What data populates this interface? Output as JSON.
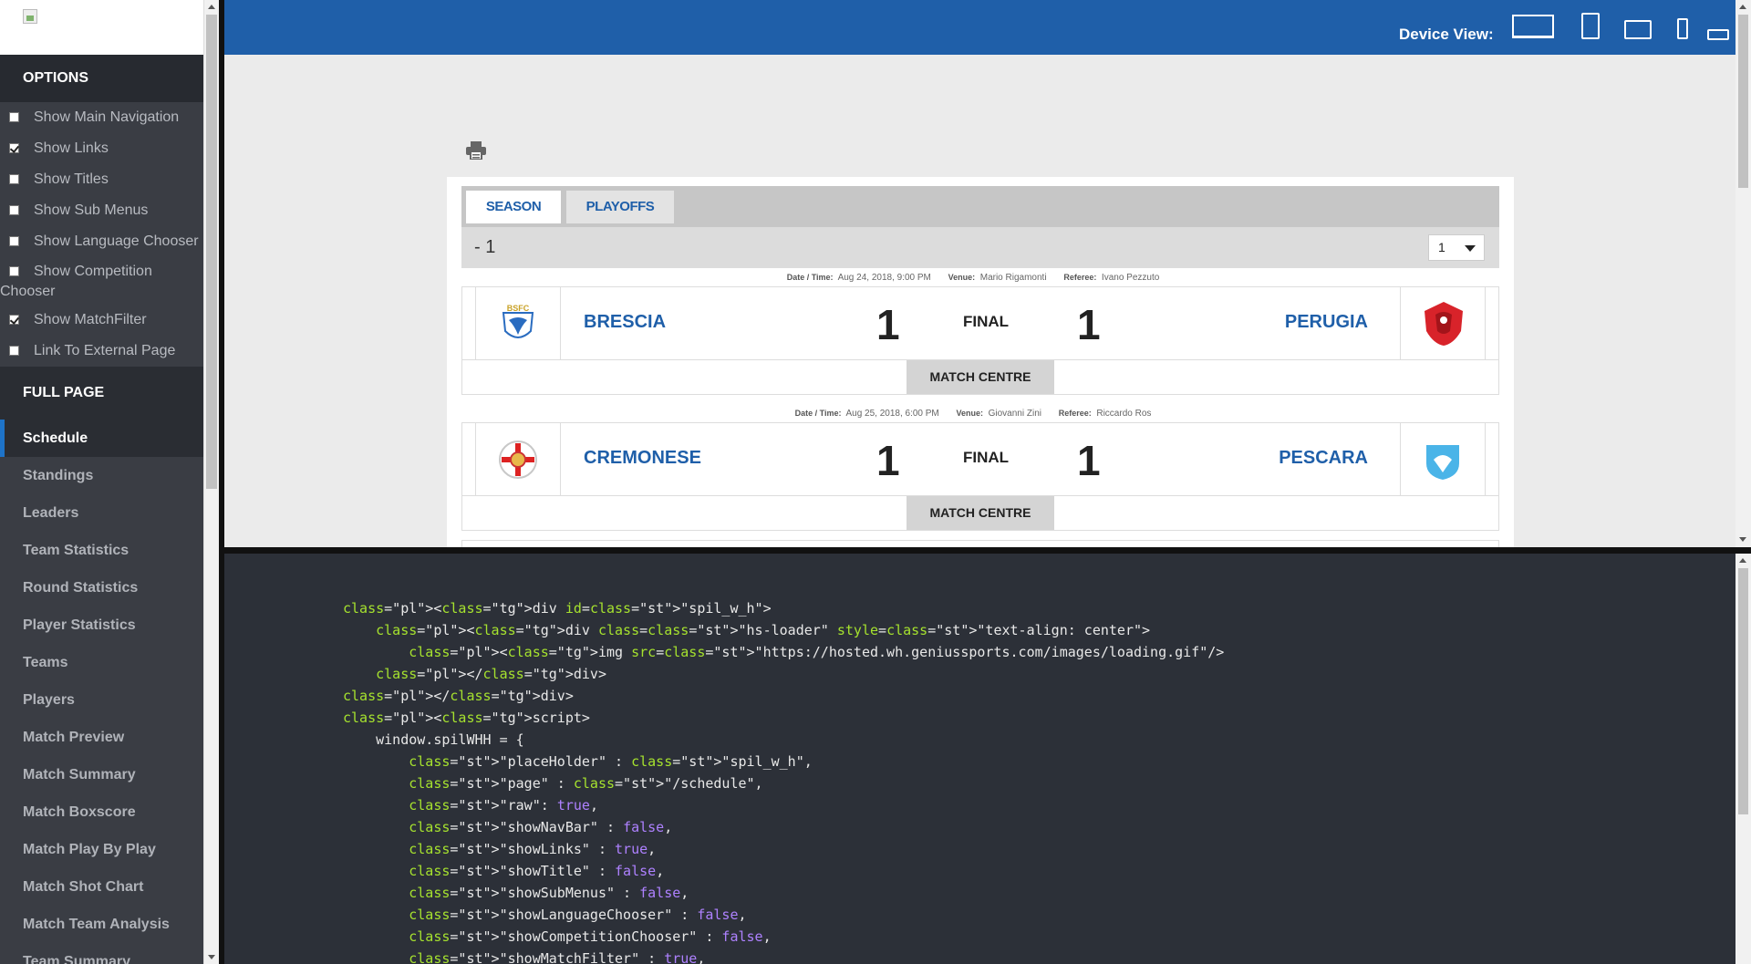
{
  "sidebar": {
    "options_title": "OPTIONS",
    "options": [
      {
        "label": "Show Main Navigation",
        "checked": false
      },
      {
        "label": "Show Links",
        "checked": true
      },
      {
        "label": "Show Titles",
        "checked": false
      },
      {
        "label": "Show Sub Menus",
        "checked": false
      },
      {
        "label": "Show Language Chooser",
        "checked": false
      },
      {
        "label": "Show Competition",
        "label2": "Chooser",
        "checked": false
      },
      {
        "label": "Show MatchFilter",
        "checked": true
      },
      {
        "label": "Link To External Page",
        "checked": false
      }
    ],
    "full_page_title": "FULL PAGE",
    "nav": [
      "Schedule",
      "Standings",
      "Leaders",
      "Team Statistics",
      "Round Statistics",
      "Player Statistics",
      "Teams",
      "Players",
      "Match Preview",
      "Match Summary",
      "Match Boxscore",
      "Match Play By Play",
      "Match Shot Chart",
      "Match Team Analysis",
      "Team Summary"
    ]
  },
  "topbar": {
    "device_view_label": "Device View:"
  },
  "widget": {
    "tabs": [
      "SEASON",
      "PLAYOFFS"
    ],
    "round_label": "- 1",
    "round_value": "1",
    "meta_labels": {
      "date": "Date / Time:",
      "venue": "Venue:",
      "referee": "Referee:"
    },
    "matches": [
      {
        "datetime": "Aug 24, 2018, 9:00 PM",
        "venue": "Mario Rigamonti",
        "referee": "Ivano Pezzuto",
        "home": "BRESCIA",
        "home_score": "1",
        "status": "FINAL",
        "away_score": "1",
        "away": "PERUGIA",
        "button": "MATCH CENTRE"
      },
      {
        "datetime": "Aug 25, 2018, 6:00 PM",
        "venue": "Giovanni Zini",
        "referee": "Riccardo Ros",
        "home": "CREMONESE",
        "home_score": "1",
        "status": "FINAL",
        "away_score": "1",
        "away": "PESCARA",
        "button": "MATCH CENTRE"
      }
    ]
  },
  "code": {
    "lines": [
      "<div id=\"spil_w_h\">",
      "    <div class=\"hs-loader\" style=\"text-align: center\">",
      "        <img src=\"https://hosted.wh.geniussports.com/images/loading.gif\"/>",
      "    </div>",
      "</div>",
      "<script>",
      "    window.spilWHH = {",
      "        \"placeHolder\" : \"spil_w_h\",",
      "        \"page\" : \"/schedule\",",
      "        \"raw\": true,",
      "        \"showNavBar\" : false,",
      "        \"showLinks\" : true,",
      "        \"showTitle\" : false,",
      "        \"showSubMenus\" : false,",
      "        \"showLanguageChooser\" : false,",
      "        \"showCompetitionChooser\" : false,",
      "        \"showMatchFilter\" : true,"
    ]
  },
  "colors": {
    "brand_blue": "#1f5fa9",
    "sidebar_bg": "#3a3d44",
    "code_bg": "#2c3038"
  }
}
